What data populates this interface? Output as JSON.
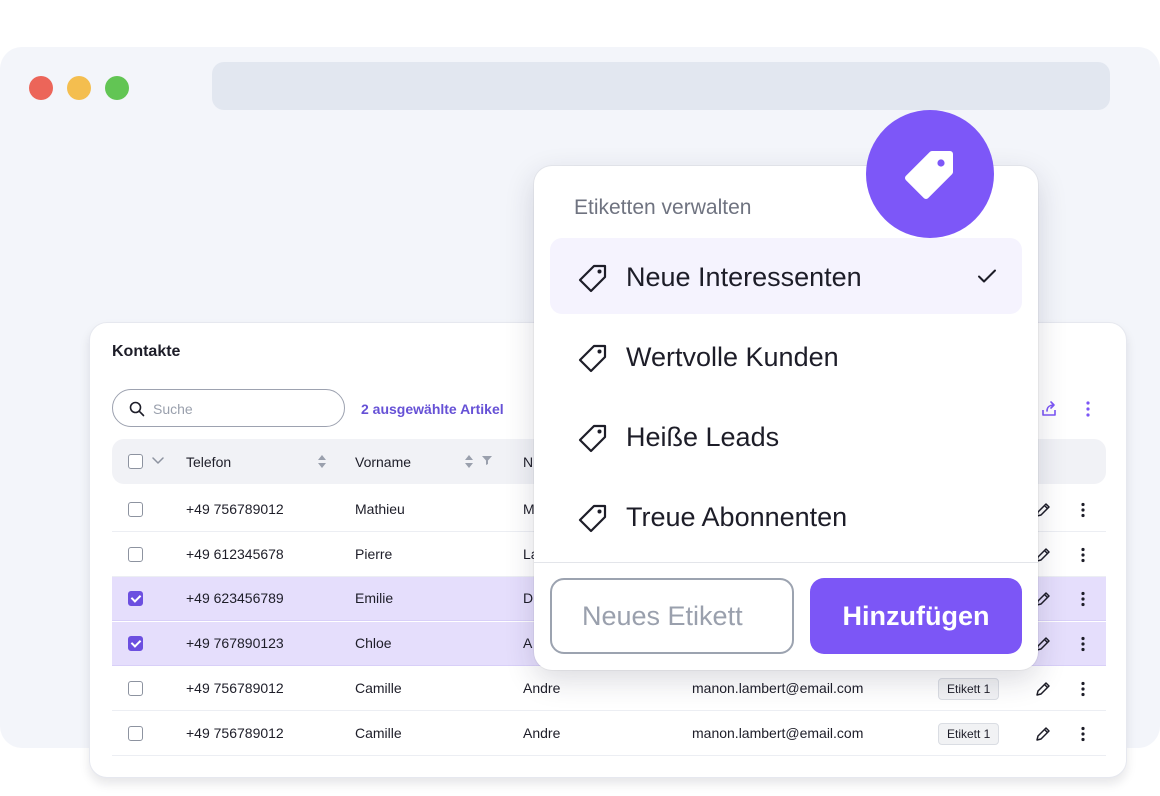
{
  "colors": {
    "accent": "#7d57f8",
    "selected_row": "#e5defc",
    "checkbox_checked": "#6c4fe0"
  },
  "contacts": {
    "title": "Kontakte",
    "search_placeholder": "Suche",
    "selected_count": "2 ausgewählte Artikel",
    "columns": [
      "Telefon",
      "Vorname",
      "N"
    ],
    "rows": [
      {
        "checked": false,
        "phone": "+49 756789012",
        "first_name": "Mathieu",
        "last_name": "M",
        "email": "",
        "tag": ""
      },
      {
        "checked": false,
        "phone": "+49 612345678",
        "first_name": "Pierre",
        "last_name": "La",
        "email": "",
        "tag": ""
      },
      {
        "checked": true,
        "phone": "+49 623456789",
        "first_name": "Emilie",
        "last_name": "D",
        "email": "",
        "tag": ""
      },
      {
        "checked": true,
        "phone": "+49 767890123",
        "first_name": "Chloe",
        "last_name": "A",
        "email": "",
        "tag": ""
      },
      {
        "checked": false,
        "phone": "+49 756789012",
        "first_name": "Camille",
        "last_name": "Andre",
        "email": "manon.lambert@email.com",
        "tag": "Etikett 1"
      },
      {
        "checked": false,
        "phone": "+49 756789012",
        "first_name": "Camille",
        "last_name": "Andre",
        "email": "manon.lambert@email.com",
        "tag": "Etikett 1"
      }
    ]
  },
  "tag_menu": {
    "title": "Etiketten verwalten",
    "options": [
      {
        "label": "Neue Interessenten",
        "selected": true
      },
      {
        "label": "Wertvolle Kunden",
        "selected": false
      },
      {
        "label": "Heiße Leads",
        "selected": false
      },
      {
        "label": "Treue Abonnenten",
        "selected": false
      }
    ],
    "new_tag_placeholder": "Neues Etikett",
    "add_button": "Hinzufügen"
  }
}
